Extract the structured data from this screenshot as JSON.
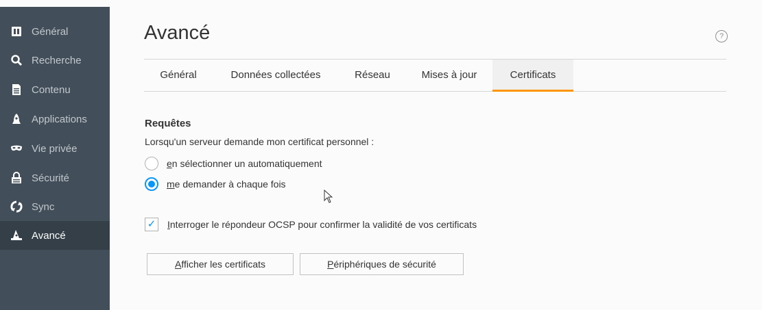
{
  "sidebar": {
    "items": [
      {
        "label": "Général",
        "icon": "general-icon"
      },
      {
        "label": "Recherche",
        "icon": "search-icon"
      },
      {
        "label": "Contenu",
        "icon": "document-icon"
      },
      {
        "label": "Applications",
        "icon": "rocket-icon"
      },
      {
        "label": "Vie privée",
        "icon": "mask-icon"
      },
      {
        "label": "Sécurité",
        "icon": "lock-icon"
      },
      {
        "label": "Sync",
        "icon": "sync-icon"
      },
      {
        "label": "Avancé",
        "icon": "wizard-hat-icon",
        "selected": true
      }
    ]
  },
  "page": {
    "title": "Avancé",
    "help": "?"
  },
  "tabs": [
    {
      "label": "Général"
    },
    {
      "label": "Données collectées"
    },
    {
      "label": "Réseau"
    },
    {
      "label": "Mises à jour"
    },
    {
      "label": "Certificats",
      "selected": true
    }
  ],
  "requests": {
    "heading": "Requêtes",
    "description": "Lorsqu'un serveur demande mon certificat personnel :",
    "option_auto": {
      "accesskey": "e",
      "rest": "n sélectionner un automatiquement",
      "checked": false
    },
    "option_ask": {
      "accesskey": "m",
      "rest": "e demander à chaque fois",
      "checked": true
    }
  },
  "ocsp": {
    "accesskey": "I",
    "rest": "nterroger le répondeur OCSP pour confirmer la validité de vos certificats",
    "checked": true,
    "checkmark": "✓"
  },
  "buttons": {
    "view_certs": {
      "accesskey": "A",
      "rest": "fficher les certificats"
    },
    "security_devices": {
      "accesskey": "P",
      "rest": "ériphériques de sécurité"
    }
  },
  "colors": {
    "sidebar_bg": "#424f5a",
    "sidebar_selected": "#343f48",
    "accent": "#0996f8",
    "tab_indicator": "#ff9500"
  }
}
